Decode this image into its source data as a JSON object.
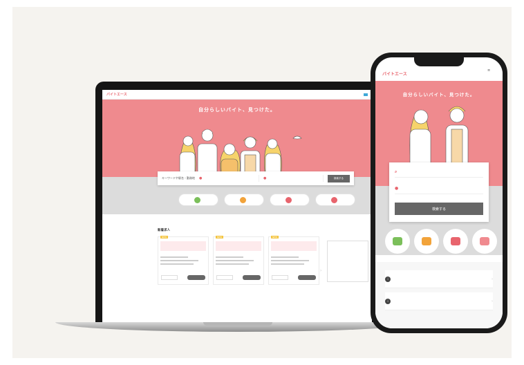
{
  "laptop": {
    "logo": "バイトエース",
    "tagline": "",
    "nav": [
      "",
      "",
      "",
      ""
    ],
    "login": "",
    "hero_title": "自分らしいバイト、見つけた。",
    "search": {
      "label": "キーワードや駅名・勤務地",
      "keyword_placeholder": "",
      "location_placeholder": "",
      "button": "検索する"
    },
    "categories": [
      {
        "label": "",
        "color": "#7bbf5a"
      },
      {
        "label": "",
        "color": "#f2a33a"
      },
      {
        "label": "",
        "color": "#e8646d"
      },
      {
        "label": "",
        "color": "#e8646d"
      }
    ],
    "section_title": "新着求人",
    "cards": [
      {
        "badge": "NEW",
        "desc": "",
        "btn_left": "",
        "btn_right": ""
      },
      {
        "badge": "NEW",
        "desc": "",
        "btn_left": "",
        "btn_right": ""
      },
      {
        "badge": "NEW",
        "desc": "",
        "btn_left": "",
        "btn_right": ""
      }
    ],
    "ad_text": "",
    "side_text": ""
  },
  "phone": {
    "logo": "バイトエース",
    "menu": "",
    "hero_title": "自分らしいバイト、見つけた。",
    "banner": "",
    "search": {
      "keyword_placeholder": "",
      "location_placeholder": "",
      "required": "",
      "button": "検索する"
    },
    "categories": [
      {
        "label": "",
        "color": "#7bbf5a"
      },
      {
        "label": "",
        "color": "#f2a33a"
      },
      {
        "label": "",
        "color": "#e8646d"
      },
      {
        "label": "",
        "color": "#f08a8f"
      }
    ],
    "news": [
      {
        "date": "",
        "title": ""
      },
      {
        "date": "",
        "title": ""
      }
    ]
  },
  "colors": {
    "brand_pink": "#ef8a8e",
    "accent": "#e8646d",
    "button_gray": "#666666"
  }
}
